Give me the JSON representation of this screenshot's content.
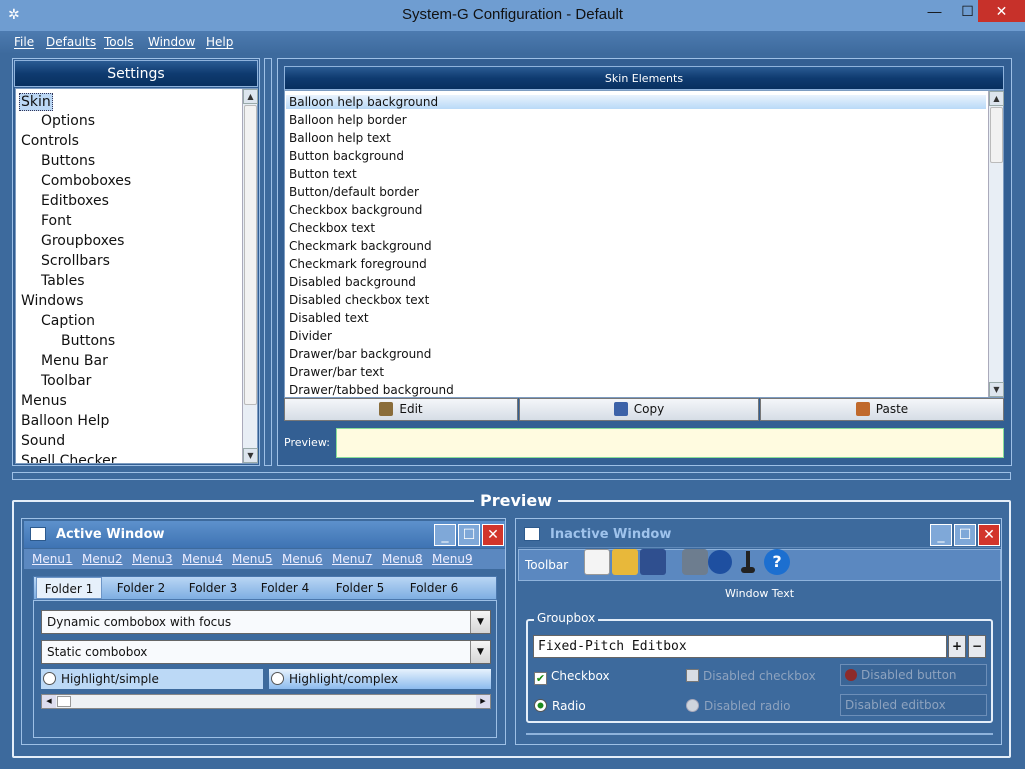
{
  "window": {
    "title": "System-G Configuration - Default",
    "minimize": "—",
    "maximize": "☐",
    "close": "✕"
  },
  "menubar": [
    "File",
    "Defaults",
    "Tools",
    "Window",
    "Help"
  ],
  "settings": {
    "header": "Settings",
    "tree": [
      {
        "label": "Skin",
        "level": 0,
        "selected": true
      },
      {
        "label": "Options",
        "level": 1
      },
      {
        "label": "Controls",
        "level": 0
      },
      {
        "label": "Buttons",
        "level": 1
      },
      {
        "label": "Comboboxes",
        "level": 1
      },
      {
        "label": "Editboxes",
        "level": 1
      },
      {
        "label": "Font",
        "level": 1
      },
      {
        "label": "Groupboxes",
        "level": 1
      },
      {
        "label": "Scrollbars",
        "level": 1
      },
      {
        "label": "Tables",
        "level": 1
      },
      {
        "label": "Windows",
        "level": 0
      },
      {
        "label": "Caption",
        "level": 1
      },
      {
        "label": "Buttons",
        "level": 2
      },
      {
        "label": "Menu Bar",
        "level": 1
      },
      {
        "label": "Toolbar",
        "level": 1
      },
      {
        "label": "Menus",
        "level": 0
      },
      {
        "label": "Balloon Help",
        "level": 0
      },
      {
        "label": "Sound",
        "level": 0
      },
      {
        "label": "Spell Checker",
        "level": 0
      }
    ]
  },
  "skin_elements": {
    "header": "Skin Elements",
    "items": [
      "Balloon help background",
      "Balloon help border",
      "Balloon help text",
      "Button background",
      "Button text",
      "Button/default border",
      "Checkbox background",
      "Checkbox text",
      "Checkmark background",
      "Checkmark foreground",
      "Disabled background",
      "Disabled checkbox text",
      "Disabled text",
      "Divider",
      "Drawer/bar background",
      "Drawer/bar text",
      "Drawer/tabbed background"
    ],
    "selected": 0,
    "buttons": {
      "edit": "Edit",
      "copy": "Copy",
      "paste": "Paste"
    },
    "preview_label": "Preview:"
  },
  "preview": {
    "title": "Preview",
    "active_window": {
      "title": "Active Window",
      "menus": [
        "Menu1",
        "Menu2",
        "Menu3",
        "Menu4",
        "Menu5",
        "Menu6",
        "Menu7",
        "Menu8",
        "Menu9"
      ],
      "tabs": [
        "Folder 1",
        "Folder 2",
        "Folder 3",
        "Folder 4",
        "Folder 5",
        "Folder 6"
      ],
      "combo1": "Dynamic combobox with focus",
      "combo2": "Static combobox",
      "radio1": "Highlight/simple",
      "radio2": "Highlight/complex"
    },
    "inactive_window": {
      "title": "Inactive Window",
      "toolbar_label": "Toolbar",
      "window_text": "Window Text",
      "groupbox": "Groupbox",
      "editbox": "Fixed-Pitch Editbox",
      "checkbox": "Checkbox",
      "disabled_checkbox": "Disabled checkbox",
      "disabled_button": "Disabled button",
      "radio": "Radio",
      "disabled_radio": "Disabled radio",
      "disabled_editbox": "Disabled editbox",
      "plus": "+",
      "minus": "−"
    }
  },
  "colors": {
    "accent": "#3d6a9d",
    "selection": "#bcd8f5",
    "close_red": "#c7312a"
  }
}
